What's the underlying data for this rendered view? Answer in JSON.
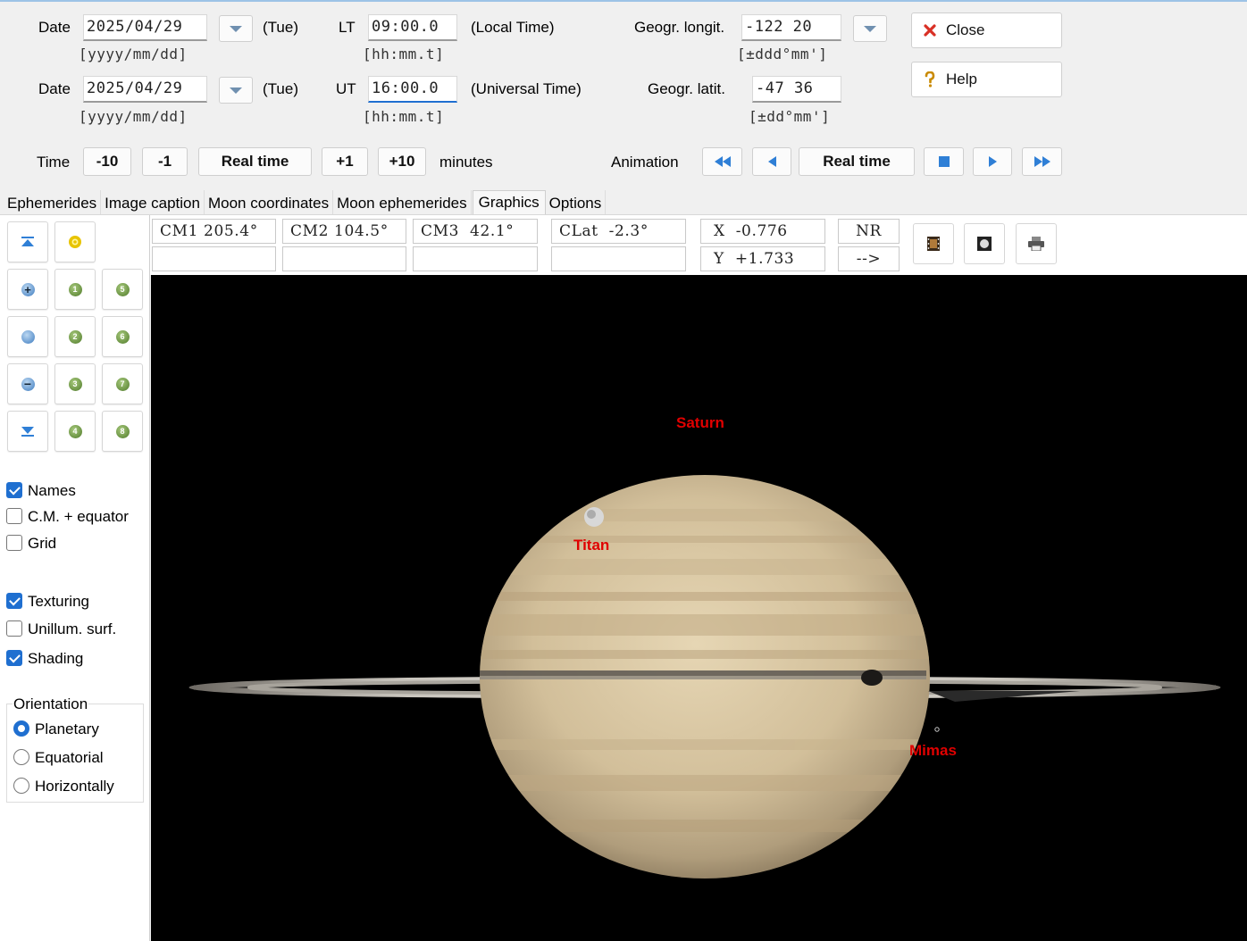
{
  "row1": {
    "date_label": "Date",
    "date_value": "2025/04/29",
    "date_hint": "[yyyy/mm/dd]",
    "weekday": "(Tue)",
    "time_label": "LT",
    "time_value": "09:00.0",
    "time_hint": "[hh:mm.t]",
    "time_desc": "(Local Time)",
    "geo_label": "Geogr. longit.",
    "geo_value": "-122 20",
    "geo_hint": "[±ddd°mm']"
  },
  "row2": {
    "date_label": "Date",
    "date_value": "2025/04/29",
    "date_hint": "[yyyy/mm/dd]",
    "weekday": "(Tue)",
    "time_label": "UT",
    "time_value": "16:00.0",
    "time_hint": "[hh:mm.t]",
    "time_desc": "(Universal Time)",
    "geo_label": "Geogr. latit.",
    "geo_value": "-47 36",
    "geo_hint": "[±dd°mm']"
  },
  "actions": {
    "close": "Close",
    "help": "Help"
  },
  "time_controls": {
    "label": "Time",
    "minus10": "-10",
    "minus1": "-1",
    "realtime": "Real time",
    "plus1": "+1",
    "plus10": "+10",
    "unit": "minutes"
  },
  "animation": {
    "label": "Animation",
    "realtime": "Real time"
  },
  "tabs": [
    "Ephemerides",
    "Image caption",
    "Moon coordinates",
    "Moon ephemerides",
    "Graphics",
    "Options"
  ],
  "info": {
    "cm1": "CM1 205.4°",
    "cm2": "CM2 104.5°",
    "cm3": "CM3  42.1°",
    "clat": "CLat  -2.3°",
    "x": "X  -0.776",
    "y": "Y  +1.733",
    "nr": "NR",
    "arrow": "-->"
  },
  "moon_buttons": [
    "1",
    "2",
    "3",
    "4",
    "5",
    "6",
    "7",
    "8"
  ],
  "checkboxes": {
    "names": "Names",
    "cm_equator": "C.M. + equator",
    "grid": "Grid",
    "texturing": "Texturing",
    "unillum": "Unillum. surf.",
    "shading": "Shading"
  },
  "orientation": {
    "legend": "Orientation",
    "planetary": "Planetary",
    "equatorial": "Equatorial",
    "horizontally": "Horizontally"
  },
  "view": {
    "saturn": "Saturn",
    "titan": "Titan",
    "mimas": "Mimas"
  },
  "colors": {
    "accent": "#1f6fd0",
    "label_red": "#e00000",
    "sky": "#000000"
  }
}
